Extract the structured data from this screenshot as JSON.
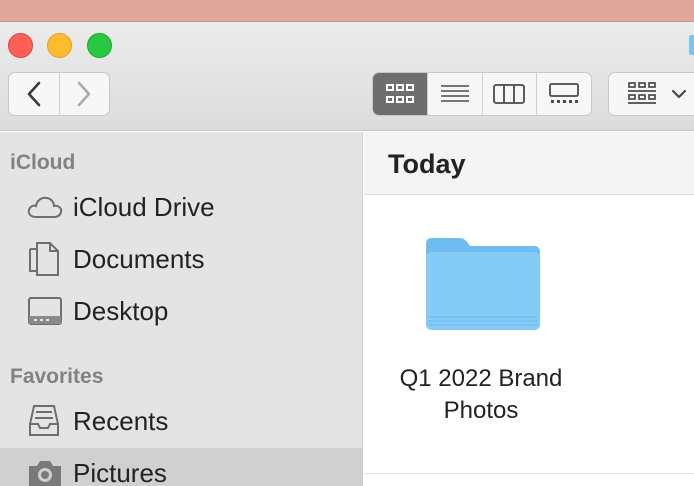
{
  "window": {
    "controls": [
      "close",
      "minimize",
      "zoom"
    ]
  },
  "toolbar": {
    "back_icon": "chevron-left-icon",
    "forward_icon": "chevron-right-icon",
    "view_modes": [
      {
        "name": "icon-view",
        "icon": "grid-icon",
        "active": true
      },
      {
        "name": "list-view",
        "icon": "list-icon",
        "active": false
      },
      {
        "name": "column-view",
        "icon": "columns-icon",
        "active": false
      },
      {
        "name": "gallery-view",
        "icon": "gallery-icon",
        "active": false
      }
    ],
    "group_icon": "group-grid-icon",
    "group_chevron": "chevron-down-icon"
  },
  "sidebar": {
    "sections": [
      {
        "label": "iCloud",
        "items": [
          {
            "label": "iCloud Drive",
            "icon": "cloud-icon"
          },
          {
            "label": "Documents",
            "icon": "document-icon"
          },
          {
            "label": "Desktop",
            "icon": "desktop-icon"
          }
        ]
      },
      {
        "label": "Favorites",
        "items": [
          {
            "label": "Recents",
            "icon": "recents-icon"
          },
          {
            "label": "Pictures",
            "icon": "camera-icon",
            "selected": true
          }
        ]
      }
    ]
  },
  "content": {
    "group_title": "Today",
    "items": [
      {
        "name_line1": "Q1 2022 Brand",
        "name_line2": "Photos",
        "icon": "folder-icon"
      }
    ]
  },
  "colors": {
    "folder": "#7ec8f4",
    "close": "#fe5f57",
    "minimize": "#febc2e",
    "zoom": "#28c840",
    "active_view": "#6e6e6e"
  }
}
